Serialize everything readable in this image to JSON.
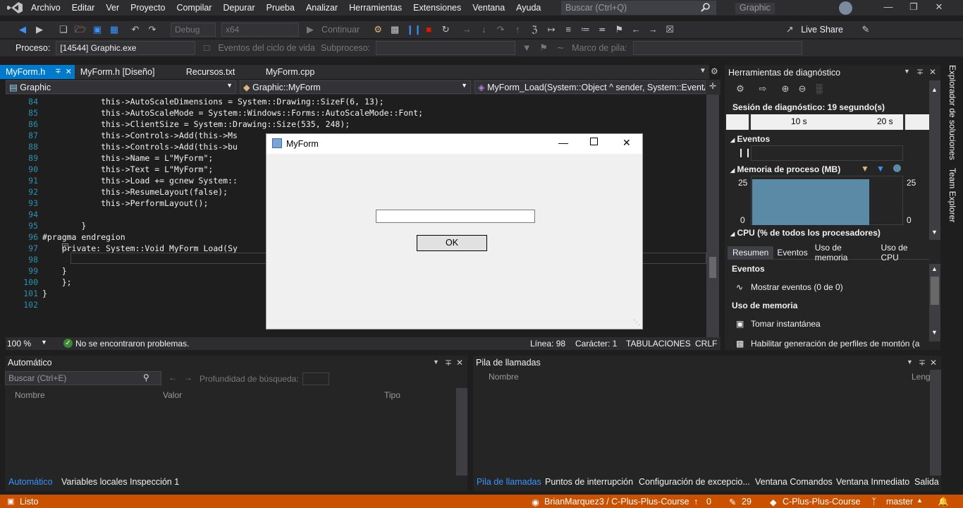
{
  "menu": {
    "items": [
      "Archivo",
      "Editar",
      "Ver",
      "Proyecto",
      "Compilar",
      "Depurar",
      "Prueba",
      "Analizar",
      "Herramientas",
      "Extensiones",
      "Ventana",
      "Ayuda"
    ],
    "search_placeholder": "Buscar (Ctrl+Q)",
    "window_title": "Graphic"
  },
  "toolbar": {
    "config": "Debug",
    "platform": "x64",
    "continue_label": "Continuar",
    "live_share": "Live Share",
    "process_label": "Proceso:",
    "process_value": "[14544] Graphic.exe",
    "lifecycle_label": "Eventos del ciclo de vida",
    "thread_label": "Subproceso:",
    "stack_frame_label": "Marco de pila:"
  },
  "tabs": [
    "MyForm.h",
    "MyForm.h [Diseño]",
    "Recursos.txt",
    "MyForm.cpp"
  ],
  "nav": {
    "project": "Graphic",
    "class": "Graphic::MyForm",
    "member": "MyForm_Load(System::Object ^ sender, System::EventA"
  },
  "code_lines": [
    {
      "n": "84",
      "t": "            this->AutoScaleDimensions = System::Drawing::SizeF(6, 13);"
    },
    {
      "n": "85",
      "t": "            this->AutoScaleMode = System::Windows::Forms::AutoScaleMode::Font;"
    },
    {
      "n": "86",
      "t": "            this->ClientSize = System::Drawing::Size(535, 248);"
    },
    {
      "n": "87",
      "t": "            this->Controls->Add(this->Ms"
    },
    {
      "n": "88",
      "t": "            this->Controls->Add(this->bu"
    },
    {
      "n": "89",
      "t": "            this->Name = L\"MyForm\";"
    },
    {
      "n": "90",
      "t": "            this->Text = L\"MyForm\";"
    },
    {
      "n": "91",
      "t": "            this->Load += gcnew System::"
    },
    {
      "n": "92",
      "t": "            this->ResumeLayout(false);"
    },
    {
      "n": "93",
      "t": "            this->PerformLayout();"
    },
    {
      "n": "94",
      "t": ""
    },
    {
      "n": "95",
      "t": "        }"
    },
    {
      "n": "96",
      "t": "#pragma endregion"
    },
    {
      "n": "97",
      "t": "    private: System::Void MyForm_Load(Sy"
    },
    {
      "n": "98",
      "t": ""
    },
    {
      "n": "99",
      "t": "    }"
    },
    {
      "n": "100",
      "t": "    };"
    },
    {
      "n": "101",
      "t": "}"
    },
    {
      "n": "102",
      "t": ""
    }
  ],
  "editor_status": {
    "zoom": "100 %",
    "problems": "No se encontraron problemas.",
    "line": "Línea: 98",
    "col": "Carácter: 1",
    "tabs": "TABULACIONES",
    "eol": "CRLF"
  },
  "dialog": {
    "title": "MyForm",
    "ok_label": "OK"
  },
  "diag": {
    "title": "Herramientas de diagnóstico",
    "session": "Sesión de diagnóstico: 19 segundo(s)",
    "tick1": "10 s",
    "tick2": "20 s",
    "events_label": "Eventos",
    "memory_label": "Memoria de proceso (MB)",
    "mem_max": "25",
    "mem_min": "0",
    "mem_value": 24,
    "cpu_label": "CPU (% de todos los procesadores)",
    "tabs": [
      "Resumen",
      "Eventos",
      "Uso de memoria",
      "Uso de CPU"
    ],
    "events_section": "Eventos",
    "show_events": "Mostrar eventos (0 de 0)",
    "memory_section": "Uso de memoria",
    "snapshot": "Tomar instantánea",
    "heap_profile": "Habilitar generación de perfiles de montón (a"
  },
  "side_tabs": [
    "Explorador de soluciones",
    "Team Explorer"
  ],
  "auto_panel": {
    "title": "Automático",
    "search_placeholder": "Buscar (Ctrl+E)",
    "depth_label": "Profundidad de búsqueda:",
    "cols": [
      "Nombre",
      "Valor",
      "Tipo"
    ],
    "tabs": [
      "Automático",
      "Variables locales",
      "Inspección 1"
    ]
  },
  "stack_panel": {
    "title": "Pila de llamadas",
    "cols": [
      "Nombre",
      "Leng"
    ],
    "tabs": [
      "Pila de llamadas",
      "Puntos de interrupción",
      "Configuración de excepcio...",
      "Ventana Comandos",
      "Ventana Inmediato",
      "Salida"
    ]
  },
  "status": {
    "ready": "Listo",
    "repo_path": "BrianMarquez3 / C-Plus-Plus-Course",
    "up_count": "0",
    "changes": "29",
    "repo": "C-Plus-Plus-Course",
    "branch": "master"
  },
  "colors": {
    "accent": "#007acc",
    "statusbar": "#ca5100",
    "memory_fill": "#5b8aa6"
  }
}
